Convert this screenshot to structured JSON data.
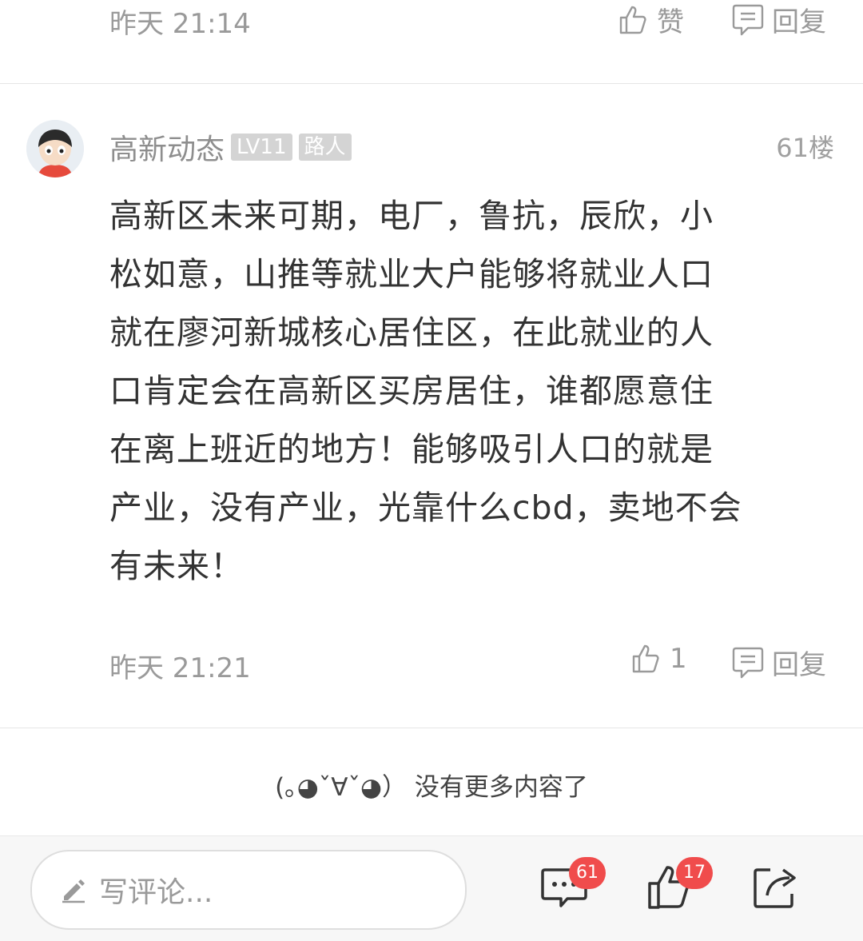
{
  "prev": {
    "time": "昨天 21:14",
    "like_label": "赞",
    "reply_label": "回复"
  },
  "comment": {
    "username": "高新动态",
    "level": "LV11",
    "title_badge": "路人",
    "floor": "61楼",
    "lines": [
      "高新区未来可期，电厂，鲁抗，辰欣，小",
      "松如意，山推等就业大户能够将就业人口",
      "就在廖河新城核心居住区，在此就业的人",
      "口肯定会在高新区买房居住，谁都愿意住",
      "在离上班近的地方！能够吸引人口的就是",
      "产业，没有产业，光靠什么cbd，卖地不会",
      "有未来！"
    ],
    "time": "昨天 21:21",
    "likes": "1",
    "reply_label": "回复"
  },
  "end_text": "(｡◕ˇ∀ˇ◕） 没有更多内容了",
  "bottom": {
    "placeholder": "写评论...",
    "comment_count": "61",
    "like_count": "17"
  },
  "colors": {
    "badge": "#f04c4c",
    "muted": "#9a9a9a",
    "text": "#333333"
  },
  "icons": [
    "thumbs-up-icon",
    "reply-icon",
    "pencil-icon",
    "comment-icon",
    "share-icon"
  ]
}
